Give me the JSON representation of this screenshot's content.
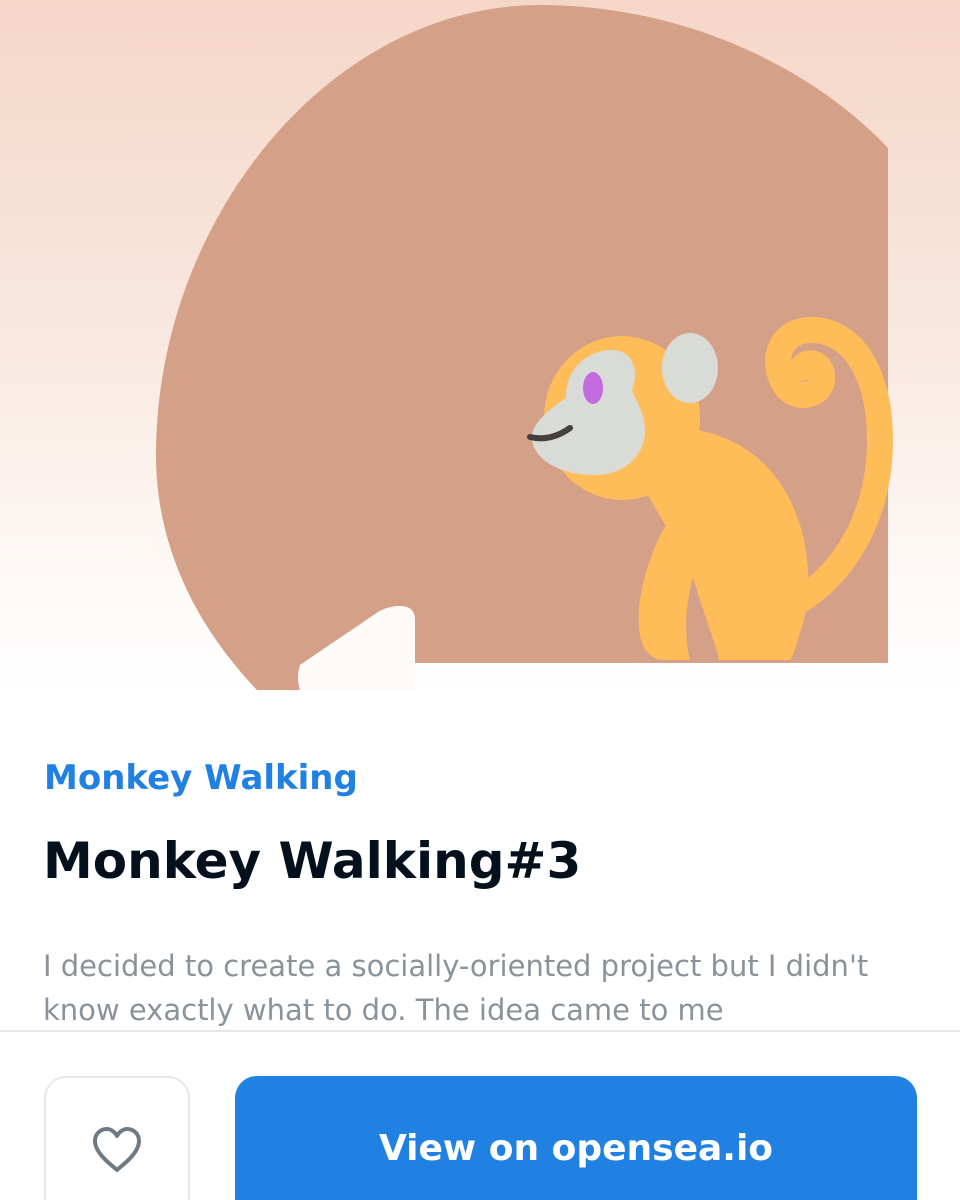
{
  "nft": {
    "collection_name": "Monkey Walking",
    "item_name": "Monkey Walking#3",
    "description": "I decided to create a socially-oriented project but I didn't know exactly what to do. The idea came to me"
  },
  "image": {
    "subject": "walking monkey",
    "colors": {
      "background": "#f5d7c8",
      "disc": "#d4a188",
      "monkey_fur": "#ffbd59",
      "monkey_face": "#d9dcd6",
      "monkey_eye": "#c36ce0"
    }
  },
  "actions": {
    "favorite_icon": "heart-icon",
    "view_button_label": "View on opensea.io"
  },
  "colors": {
    "accent": "#2081e2",
    "title": "#04111d",
    "description": "#8a939b",
    "border": "#e5e8eb"
  }
}
